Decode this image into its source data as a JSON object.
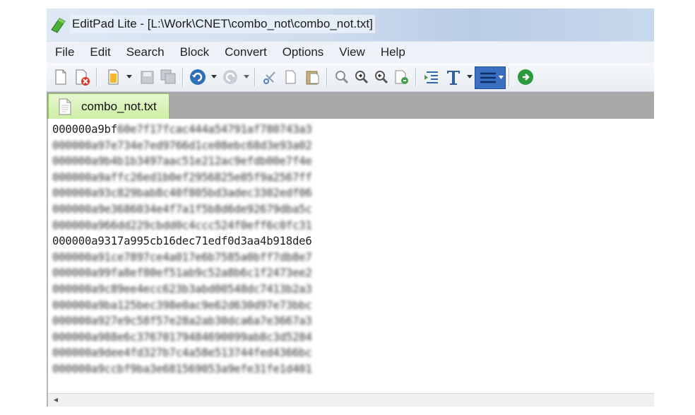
{
  "window": {
    "title": "EditPad Lite - [L:\\Work\\CNET\\combo_not\\combo_not.txt]"
  },
  "menu": {
    "items": [
      "File",
      "Edit",
      "Search",
      "Block",
      "Convert",
      "Options",
      "View",
      "Help"
    ]
  },
  "toolbar": {
    "icons": [
      "new-file-icon",
      "close-file-icon",
      "open-file-icon",
      "save-icon",
      "save-all-icon",
      "undo-icon",
      "redo-icon",
      "cut-icon",
      "copy-icon",
      "paste-icon",
      "search-icon",
      "find-next-icon",
      "find-previous-icon",
      "replace-icon",
      "indent-icon",
      "font-icon",
      "word-wrap-icon",
      "web-icon"
    ]
  },
  "tabs": [
    {
      "label": "combo_not.txt",
      "active": true
    }
  ],
  "editor": {
    "lines": [
      {
        "prefix": "000000a9bf",
        "rest": "60e7f17fcac444a54791af780743a3"
      },
      {
        "prefix": "",
        "rest": "000000a97e734e7ed9766d1ce08ebc68d3e93a02"
      },
      {
        "prefix": "",
        "rest": "000000a9b4b1b3497aac51e212ac9efdb00e7f4e"
      },
      {
        "prefix": "",
        "rest": "000000a9affc26ed1b0ef2956825e05f9a2567ff"
      },
      {
        "prefix": "",
        "rest": "000000a93c829bab8c40f805bd3adec3302edf06"
      },
      {
        "prefix": "",
        "rest": "000000a9e3686034e4f7a1f5b8d6de92679dba5c"
      },
      {
        "prefix": "",
        "rest": "000000a966dd229cbdd0c4ccc524f0eff6c0fc31"
      },
      {
        "prefix": "000000a9317a995cb16dec71edf0d3aa4b918de6",
        "rest": ""
      },
      {
        "prefix": "",
        "rest": "000000a91ce7897ce4a017e6b7585a0bff7db8e7"
      },
      {
        "prefix": "",
        "rest": "000000a99fa8ef80ef51ab9c52a8b6c1f2473ee2"
      },
      {
        "prefix": "",
        "rest": "000000a9c89ee4ecc623b3abd00548dc7413b2a3"
      },
      {
        "prefix": "",
        "rest": "000000a9ba125bec398e0ac9e62d630d97e73bbc"
      },
      {
        "prefix": "",
        "rest": "000000a927e9c58f57e28a2ab30dca6a7e3667a3"
      },
      {
        "prefix": "",
        "rest": "000000a988e6c37670179484690099ab8c3d5284"
      },
      {
        "prefix": "",
        "rest": "000000a9dee4fd327b7c4a58e513744fed4366bc"
      },
      {
        "prefix": "",
        "rest": "000000a9ccbf9ba3e681569053a9efe31fe1d401"
      }
    ]
  },
  "colors": {
    "tab_active": "#cdeea4",
    "tabbar": "#a8a8a8",
    "menubar": "#eef2f8"
  }
}
